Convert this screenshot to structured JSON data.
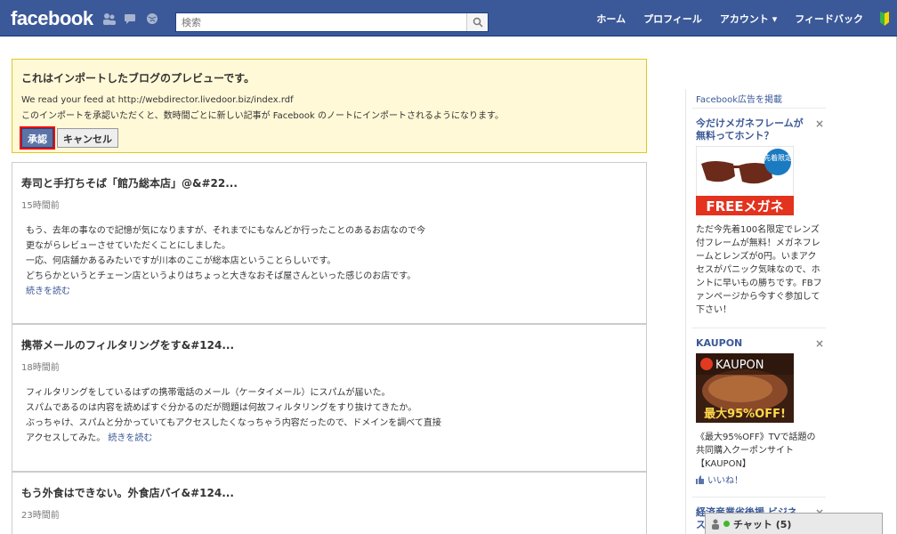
{
  "header": {
    "logo": "facebook",
    "search_placeholder": "検索",
    "nav": [
      "ホーム",
      "プロフィール",
      "アカウント ▾",
      "フィードバック"
    ]
  },
  "notice": {
    "title": "これはインポートしたブログのプレビューです。",
    "feed_line": "We read your feed at http://webdirector.livedoor.biz/index.rdf",
    "desc": "このインポートを承認いただくと、数時間ごとに新しい記事が Facebook のノートにインポートされるようになります。",
    "approve_label": "承認",
    "cancel_label": "キャンセル"
  },
  "posts": [
    {
      "title": "寿司と手打ちそば「館乃総本店」@&#22...",
      "time": "15時間前",
      "lines": [
        "もう、去年の事なので記憶が気になりますが、それまでにもなんどか行ったことのあるお店なので今",
        "更ながらレビューさせていただくことにしました。",
        "一応、何店舗かあるみたいですが川本のここが総本店ということらしいです。",
        "どちらかというとチェーン店というよりはちょっと大きなおそば屋さんといった感じのお店です。"
      ],
      "more": "続きを読む"
    },
    {
      "title": "携帯メールのフィルタリングをす&#124...",
      "time": "18時間前",
      "lines": [
        "フィルタリングをしているはずの携帯電話のメール（ケータイメール）にスパムが届いた。",
        "スパムであるのは内容を読めばすぐ分かるのだが問題は何故フィルタリングをすり抜けてきたか。",
        "ぶっちゃけ、スパムと分かっていてもアクセスしたくなっちゃう内容だったので、ドメインを調べて直接",
        "アクセスしてみた。"
      ],
      "more": "続きを読む"
    },
    {
      "title": "もう外食はできない。外食店バイ&#124...",
      "time": "23時間前"
    }
  ],
  "sidebar": {
    "ad_header": "Facebook広告を掲載",
    "ads": [
      {
        "title": "今だけメガネフレームが無料ってホント？",
        "img_text": "FREEメガネ",
        "badge": "先着限定",
        "text": "ただ今先着100名限定でレンズ付フレームが無料！メガネフレームとレンズが0円。いまアクセスがパニック気味なので、ホントに早いもの勝ちです。FBファンページから今すぐ参加して下さい！"
      },
      {
        "title": "KAUPON",
        "img_brand": "KAUPON",
        "img_text": "最大95%OFF!",
        "text": "《最大95%OFF》TVで話題の共同購入クーポンサイト【KAUPON】",
        "like": "いいね！"
      },
      {
        "title": "経済産業省後援 ビジネス..."
      }
    ]
  },
  "chat": {
    "label": "チャット (5)"
  }
}
